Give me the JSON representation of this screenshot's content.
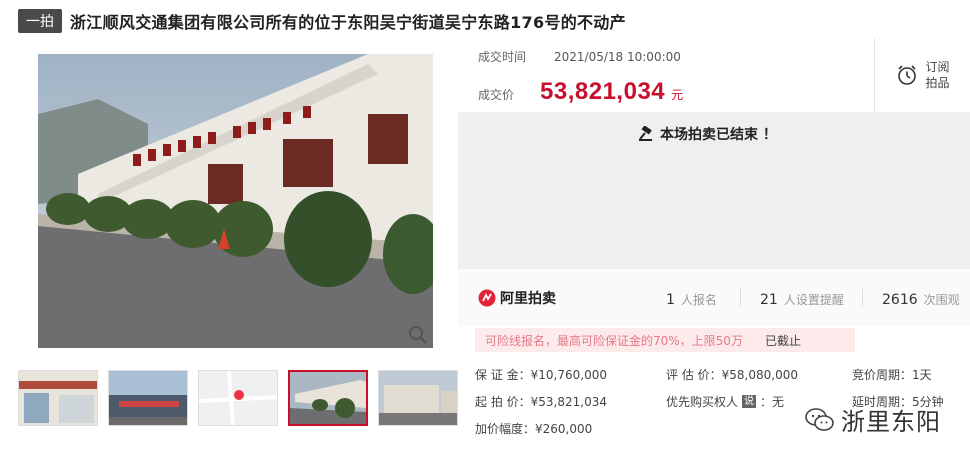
{
  "header": {
    "tag": "一拍",
    "title": "浙江顺风交通集团有限公司所有的位于东阳吴宁街道吴宁东路176号的不动产"
  },
  "deal": {
    "time_label": "成交时间",
    "time_value": "2021/05/18 10:00:00",
    "price_label": "成交价",
    "price_value": "53,821,034",
    "price_unit": "元"
  },
  "subscribe": {
    "line1": "订阅",
    "line2": "拍品",
    "icon": "alarm-clock-icon"
  },
  "ended": {
    "message": "本场拍卖已结束 ！",
    "icon": "gavel-icon"
  },
  "platform": {
    "name": "阿里拍卖",
    "icon": "ali-auction-logo"
  },
  "stats": [
    {
      "num": "1",
      "unit": "人报名"
    },
    {
      "num": "21",
      "unit": "人设置提醒"
    },
    {
      "num": "2616",
      "unit": "次围观"
    }
  ],
  "notice": {
    "text": "可险线报名，最高可险保证金的70%，上限50万",
    "status": "已截止"
  },
  "details": {
    "deposit_label": "保 证 金：",
    "deposit_value": "¥10,760,000",
    "start_label": "起 拍 价：",
    "start_value": "¥53,821,034",
    "increment_label": "加价幅度：",
    "increment_value": "¥260,000",
    "appraise_label": "评 估 价：",
    "appraise_value": "¥58,080,000",
    "priority_label": "优先购买权人",
    "priority_badge": "说",
    "priority_value": "：无",
    "cycle_label": "竞价周期：",
    "cycle_value": "1天",
    "delay_label": "延时周期：",
    "delay_value": "5分钟"
  },
  "watermark": {
    "text": "浙里东阳",
    "icon": "wechat-icon"
  },
  "colors": {
    "accent": "#c8102e",
    "ended_bg": "#efefef",
    "notice_bg": "#fdeaea"
  }
}
